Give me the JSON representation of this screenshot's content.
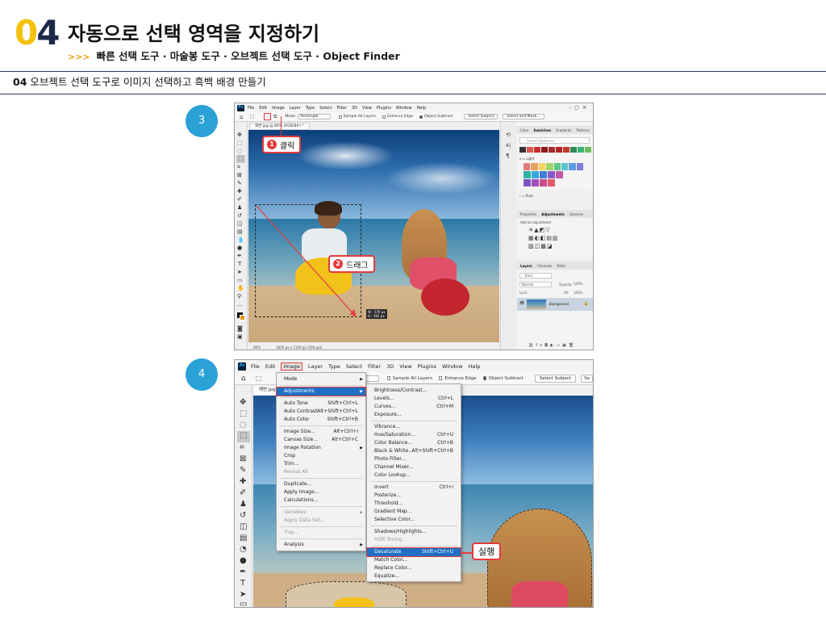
{
  "header": {
    "num_first": "0",
    "num_second": "4",
    "title": "자동으로 선택 영역을 지정하기",
    "subtitle_arrows": ">>>",
    "subtitle": "빠른 선택 도구 · 마술봉 도구 · 오브젝트 선택 도구 · Object Finder"
  },
  "section": {
    "number": "04",
    "title": "오브젝트 선택 도구로 이미지 선택하고 흑백 배경 만들기"
  },
  "steps": [
    {
      "number": "3"
    },
    {
      "number": "4"
    }
  ],
  "shot3": {
    "logo": "Ps",
    "menu": [
      "File",
      "Edit",
      "Image",
      "Layer",
      "Type",
      "Select",
      "Filter",
      "3D",
      "View",
      "Plugins",
      "Window",
      "Help"
    ],
    "options": {
      "mode_label": "Mode:",
      "mode_value": "Rectangle",
      "sample_all": "Sample All Layers",
      "enhance_edge": "Enhance Edge",
      "object_subtract": "Object Subtract",
      "select_subject": "Select Subject",
      "select_mask": "Select and Mask..."
    },
    "doc_tab": "해변.jpg @ 66% (RGB/8#) *",
    "callout_click_num": "1",
    "callout_click": "클릭",
    "callout_drag_num": "2",
    "callout_drag": "드래그",
    "drag_readout": [
      "W : 579 px",
      "H : 362 px"
    ],
    "status": [
      "66%",
      "1650 px x 1100 px (300 ppi)"
    ],
    "panels": {
      "swatch_tabs": [
        "Color",
        "Swatches",
        "Gradients",
        "Patterns"
      ],
      "swatch_search": "Search Swatches",
      "group_light": "Light",
      "group_pure": "Pure",
      "adj_tabs": [
        "Properties",
        "Adjustments",
        "Libraries"
      ],
      "adj_hint": "Add an adjustment",
      "layer_tabs": [
        "Layers",
        "Channels",
        "Paths"
      ],
      "layer_kind": "Kind",
      "layer_mode": "Normal",
      "layer_opacity_label": "Opacity:",
      "layer_opacity": "100%",
      "layer_lock_label": "Lock:",
      "layer_fill_label": "Fill:",
      "layer_fill": "100%",
      "layer_name": "Background"
    },
    "swatch_colors": {
      "row1": [
        "#e07a7a",
        "#e9a15e",
        "#f1d35e",
        "#9fd46a",
        "#5fc48c",
        "#5bc3c9",
        "#5b9be0",
        "#7b7fd9"
      ],
      "row2": [
        "#2db3a3",
        "#37a7e0",
        "#3d7fd8",
        "#8a59c8",
        "#c059a8"
      ],
      "row3": [
        "#7a55c0",
        "#a14fb8",
        "#c84c8e",
        "#e05a6a"
      ],
      "top_strip": [
        "#333333",
        "#d9534f",
        "#c9302c",
        "#8b1a1a",
        "#a52a2a",
        "#b22222",
        "#c0392b",
        "#2e8b57",
        "#3cb371",
        "#6dbb5c"
      ]
    }
  },
  "shot4": {
    "logo": "Ps",
    "menu": [
      "File",
      "Edit",
      "Image",
      "Layer",
      "Type",
      "Select",
      "Filter",
      "3D",
      "View",
      "Plugins",
      "Window",
      "Help"
    ],
    "options": {
      "mode_value": "angle",
      "sample_all": "Sample All Layers",
      "enhance_edge": "Enhance Edge",
      "object_subtract": "Object Subtract",
      "select_subject": "Select Subject",
      "select_mask": "Se"
    },
    "doc_tab": "해변.jpg",
    "image_menu": [
      {
        "label": "Mode",
        "shortcut": "",
        "submenu": true
      },
      {
        "sep": true
      },
      {
        "label": "Adjustments",
        "shortcut": "",
        "submenu": true,
        "highlight": true
      },
      {
        "sep": true
      },
      {
        "label": "Auto Tone",
        "shortcut": "Shift+Ctrl+L"
      },
      {
        "label": "Auto Contrast",
        "shortcut": "Alt+Shift+Ctrl+L"
      },
      {
        "label": "Auto Color",
        "shortcut": "Shift+Ctrl+B"
      },
      {
        "sep": true
      },
      {
        "label": "Image Size...",
        "shortcut": "Alt+Ctrl+I"
      },
      {
        "label": "Canvas Size...",
        "shortcut": "Alt+Ctrl+C"
      },
      {
        "label": "Image Rotation",
        "shortcut": "",
        "submenu": true
      },
      {
        "label": "Crop",
        "shortcut": ""
      },
      {
        "label": "Trim...",
        "shortcut": ""
      },
      {
        "label": "Reveal All",
        "shortcut": "",
        "disabled": true
      },
      {
        "sep": true
      },
      {
        "label": "Duplicate...",
        "shortcut": ""
      },
      {
        "label": "Apply Image...",
        "shortcut": ""
      },
      {
        "label": "Calculations...",
        "shortcut": ""
      },
      {
        "sep": true
      },
      {
        "label": "Variables",
        "shortcut": "",
        "submenu": true,
        "disabled": true
      },
      {
        "label": "Apply Data Set...",
        "shortcut": "",
        "disabled": true
      },
      {
        "sep": true
      },
      {
        "label": "Trap...",
        "shortcut": "",
        "disabled": true
      },
      {
        "sep": true
      },
      {
        "label": "Analysis",
        "shortcut": "",
        "submenu": true
      }
    ],
    "adjust_menu": [
      {
        "label": "Brightness/Contrast...",
        "shortcut": ""
      },
      {
        "label": "Levels...",
        "shortcut": "Ctrl+L"
      },
      {
        "label": "Curves...",
        "shortcut": "Ctrl+M"
      },
      {
        "label": "Exposure...",
        "shortcut": ""
      },
      {
        "sep": true
      },
      {
        "label": "Vibrance...",
        "shortcut": ""
      },
      {
        "label": "Hue/Saturation...",
        "shortcut": "Ctrl+U"
      },
      {
        "label": "Color Balance...",
        "shortcut": "Ctrl+B"
      },
      {
        "label": "Black & White...",
        "shortcut": "Alt+Shift+Ctrl+B"
      },
      {
        "label": "Photo Filter...",
        "shortcut": ""
      },
      {
        "label": "Channel Mixer...",
        "shortcut": ""
      },
      {
        "label": "Color Lookup...",
        "shortcut": ""
      },
      {
        "sep": true
      },
      {
        "label": "Invert",
        "shortcut": "Ctrl+I"
      },
      {
        "label": "Posterize...",
        "shortcut": ""
      },
      {
        "label": "Threshold...",
        "shortcut": ""
      },
      {
        "label": "Gradient Map...",
        "shortcut": ""
      },
      {
        "label": "Selective Color...",
        "shortcut": ""
      },
      {
        "sep": true
      },
      {
        "label": "Shadows/Highlights...",
        "shortcut": ""
      },
      {
        "label": "HDR Toning...",
        "shortcut": "",
        "disabled": true
      },
      {
        "sep": true
      },
      {
        "label": "Desaturate",
        "shortcut": "Shift+Ctrl+U",
        "highlight": true
      },
      {
        "label": "Match Color...",
        "shortcut": ""
      },
      {
        "label": "Replace Color...",
        "shortcut": ""
      },
      {
        "label": "Equalize...",
        "shortcut": ""
      }
    ],
    "callout_run": "실행"
  },
  "colors": {
    "accent_yellow": "#f4c10a",
    "navy": "#1b2a49",
    "step_blue": "#2aa2d6",
    "callout_red": "#e53a3a",
    "menu_highlight": "#1f6fc5"
  }
}
